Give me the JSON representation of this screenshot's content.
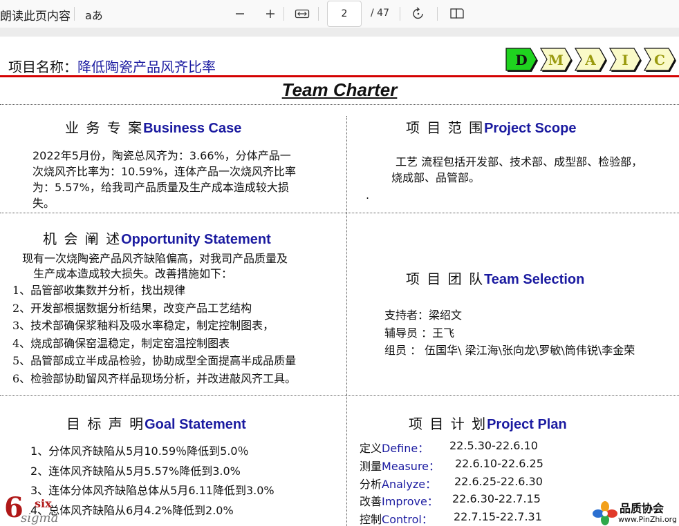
{
  "toolbar": {
    "read_aloud_label": "朗读此页内容",
    "text_options_label": "aあ",
    "page_number": "2",
    "page_total": "/ 47"
  },
  "slide": {
    "project_label": "项目名称：",
    "project_name": "降低陶瓷产品风齐比率",
    "dmaic": [
      {
        "letter": "D",
        "fill": "#1fd31f",
        "text_color": "#111111"
      },
      {
        "letter": "M",
        "fill": "#fafac8",
        "text_color": "#9a9a10"
      },
      {
        "letter": "A",
        "fill": "#fafac8",
        "text_color": "#9a9a10"
      },
      {
        "letter": "I",
        "fill": "#fafac8",
        "text_color": "#9a9a10"
      },
      {
        "letter": "C",
        "fill": "#fafac8",
        "text_color": "#9a9a10"
      }
    ],
    "title": "Team Charter",
    "business_case": {
      "heading_zh": "业  务  专  案",
      "heading_en": "Business Case",
      "lines": [
        "2022年5月份，陶瓷总风齐为：3.66%，分体产品一",
        "次烧风齐比率为：10.59%，连体产品一次烧风齐比率",
        "为：5.57%，给我司产品质量及生产成本造成较大损",
        "失。"
      ]
    },
    "project_scope": {
      "heading_zh": "项  目 范 围",
      "heading_en": "Project Scope",
      "lines": [
        "工艺 流程包括开发部、技术部、成型部、检验部，",
        "烧成部、品管部。"
      ],
      "trailing_dot": "."
    },
    "opportunity": {
      "heading_zh": "机  会   阐   述",
      "heading_en": "Opportunity Statement",
      "intro": [
        "现有一次烧陶瓷产品风齐缺陷偏高，对我司产品质量及",
        "生产成本造成较大损失。改善措施如下："
      ],
      "items": [
        "1、品管部收集数并分析，找出规律",
        "2、开发部根据数据分析结果，改变产品工艺结构",
        "3、技术部确保浆釉料及吸水率稳定，制定控制图表，",
        "4、烧成部确保窑温稳定，制定窑温控制图表",
        "5、品管部成立半成品检验，协助成型全面提高半成品质量",
        "6、检验部协助留风齐样品现场分析，并改进敲风齐工具。"
      ]
    },
    "team": {
      "heading_zh": "项  目  团  队",
      "heading_en": "Team Selection",
      "members": [
        "支持者：梁绍文",
        "辅导员 ：王飞",
        "组员 ：  伍国华\\ 梁江海\\张向龙\\罗敏\\筒伟锐\\李金荣"
      ]
    },
    "goal": {
      "heading_zh": "目   标   声   明",
      "heading_en": "Goal Statement",
      "items": [
        "1、分体风齐缺陷从5月10.59％降低到5.0％",
        "2、连体风齐缺陷从5月5.57%降低到3.0%",
        "3、连体分体风齐缺陷总体从5月6.11降低到3.0%",
        "4、总体风齐缺陷从6月4.2%降低到2.0%"
      ]
    },
    "plan": {
      "heading_zh": "项  目 计   划",
      "heading_en": "Project Plan",
      "rows": [
        {
          "zh": "定义",
          "en": "Define：",
          "dates": "22.5.30-22.6.10"
        },
        {
          "zh": "测量",
          "en": "Measure：",
          "dates": "22.6.10-22.6.25"
        },
        {
          "zh": "分析",
          "en": "Analyze：",
          "dates": "22.6.25-22.6.30"
        },
        {
          "zh": "改善",
          "en": "Improve：",
          "dates": "22.6.30-22.7.15"
        },
        {
          "zh": "控制",
          "en": "Control：",
          "dates": "22.7.15-22.7.31"
        }
      ]
    },
    "logo_six": {
      "digit": "6",
      "word": "six",
      "sigma": "sigma"
    },
    "logo_pinzhi": {
      "name": "品质协会",
      "url": "www.PinZhi.org"
    }
  }
}
